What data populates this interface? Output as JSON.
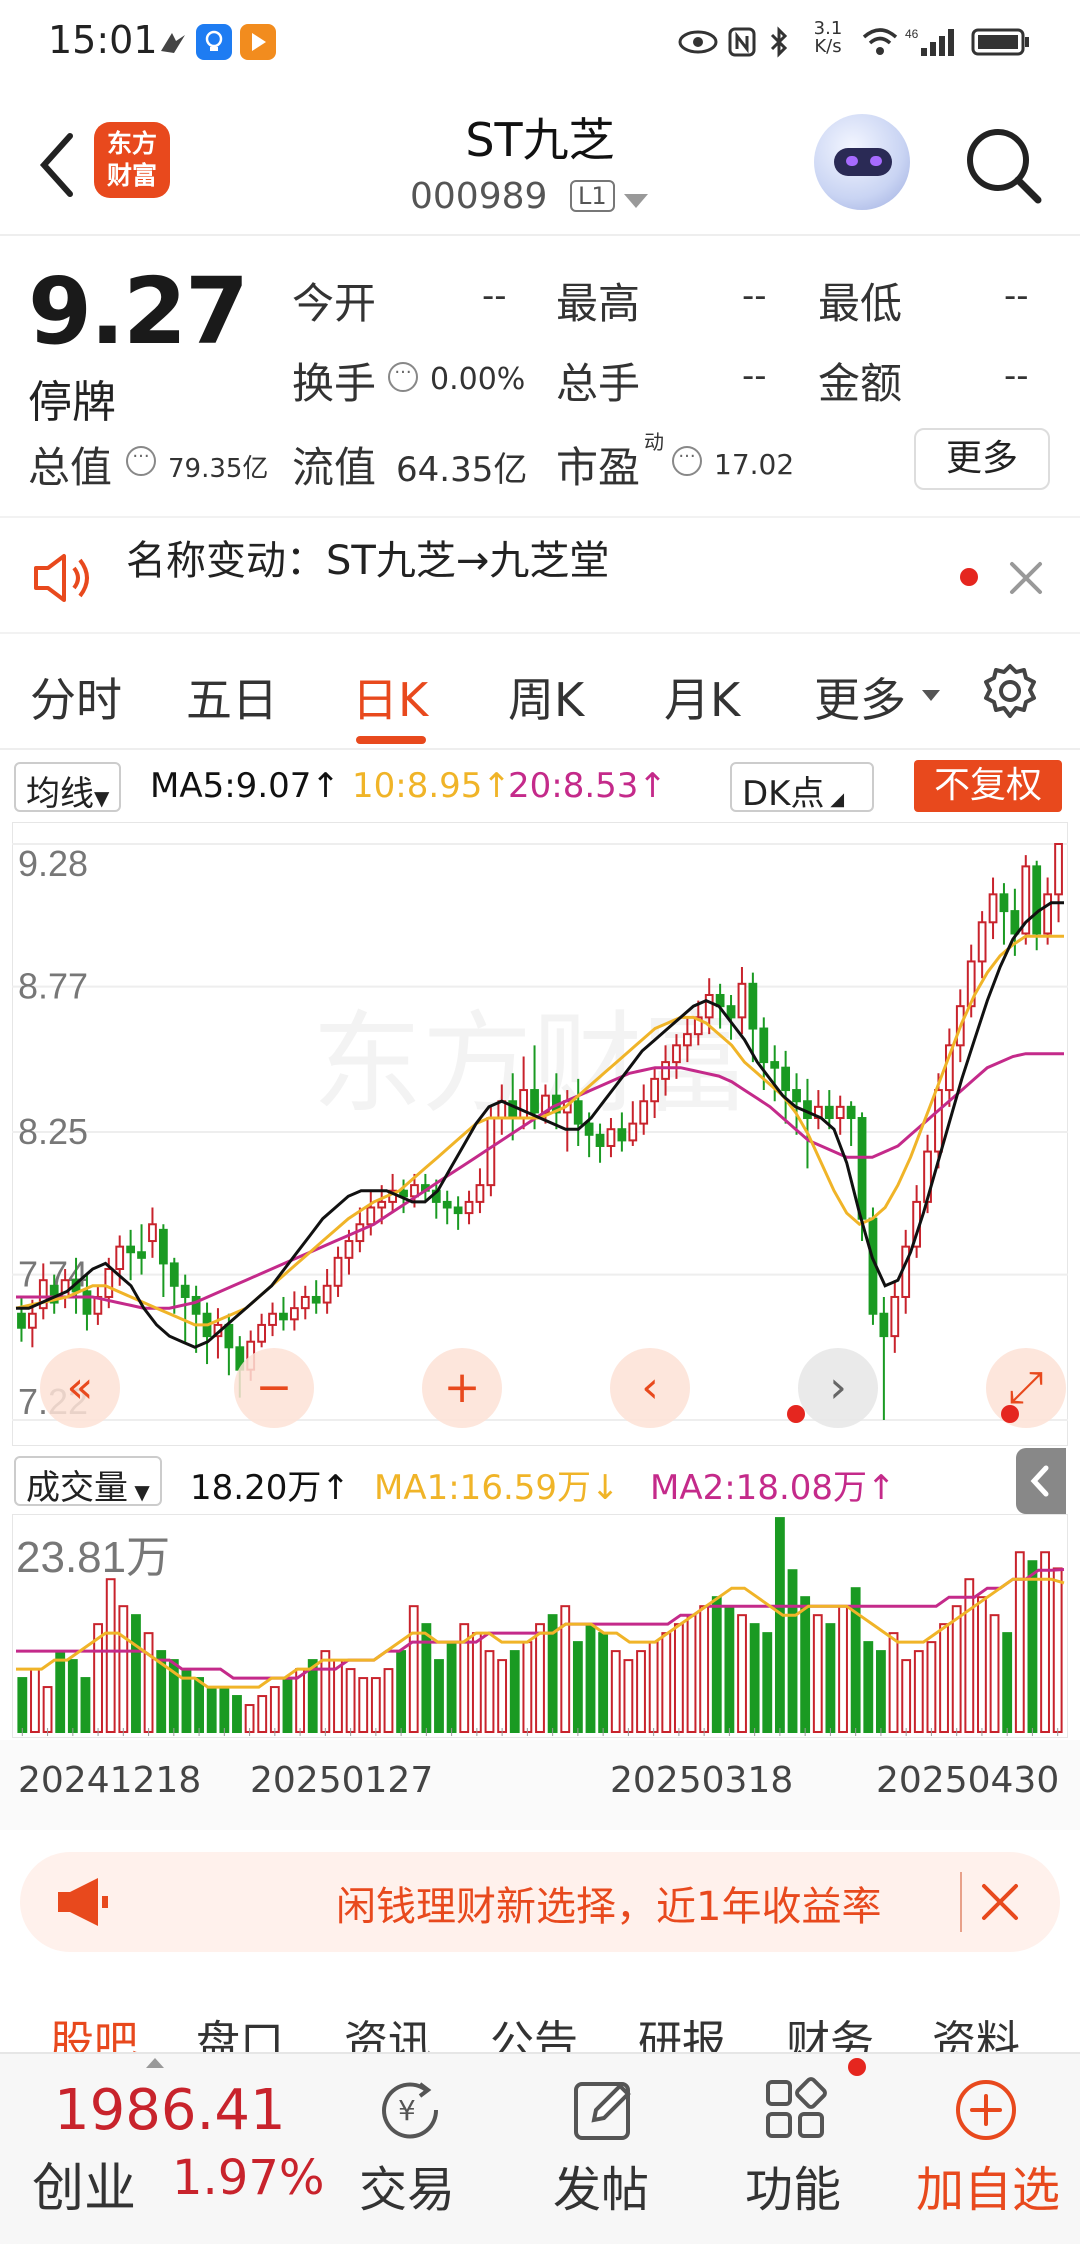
{
  "status_bar": {
    "time": "15:01",
    "net_speed": "3.1\nK/s",
    "signal": "46"
  },
  "header": {
    "logo_text": "东方\n财富",
    "stock_name": "ST九芝",
    "stock_code": "000989",
    "level_badge": "L1"
  },
  "quote": {
    "price": "9.27",
    "status": "停牌",
    "fields": {
      "open_label": "今开",
      "open_value": "--",
      "high_label": "最高",
      "high_value": "--",
      "low_label": "最低",
      "low_value": "--",
      "turnover_label": "换手",
      "turnover_value": "0.00%",
      "volume_label": "总手",
      "volume_value": "--",
      "amount_label": "金额",
      "amount_value": "--",
      "mktcap_label": "总值",
      "mktcap_value": "79.35亿",
      "float_label": "流值",
      "float_value": "64.35亿",
      "pe_label": "市盈",
      "pe_sup": "动",
      "pe_value": "17.02"
    },
    "more_button": "更多"
  },
  "notice": {
    "text": "名称变动：ST九芝→九芝堂"
  },
  "tabs": [
    "分时",
    "五日",
    "日K",
    "周K",
    "月K",
    "更多"
  ],
  "active_tab": "日K",
  "ma_row": {
    "selector": "均线",
    "ma5": "MA5:9.07↑",
    "ma10": "10:8.95↑",
    "ma20": "20:8.53↑",
    "dk": "DK点",
    "adjust": "不复权"
  },
  "colors": {
    "accent": "#e8491d",
    "up": "#c8232c",
    "down": "#1a9a22",
    "ma5": "#111111",
    "ma10": "#f0b428",
    "ma20": "#c42a8a"
  },
  "volume_row": {
    "selector": "成交量",
    "vol": "18.20万↑",
    "ma1": "MA1:16.59万↓",
    "ma2": "MA2:18.08万↑",
    "max_label": "23.81万"
  },
  "chart_data": {
    "type": "candlestick",
    "y_axis_labels": [
      "9.28",
      "8.77",
      "8.25",
      "7.74",
      "7.22"
    ],
    "ylim": [
      7.22,
      9.28
    ],
    "x_labels": [
      "20241218",
      "20250127",
      "20250318",
      "20250430"
    ],
    "candles": [
      [
        7.6,
        7.55,
        7.66,
        7.5
      ],
      [
        7.55,
        7.6,
        7.65,
        7.48
      ],
      [
        7.62,
        7.72,
        7.78,
        7.58
      ],
      [
        7.7,
        7.64,
        7.74,
        7.6
      ],
      [
        7.66,
        7.72,
        7.76,
        7.62
      ],
      [
        7.72,
        7.68,
        7.8,
        7.6
      ],
      [
        7.68,
        7.6,
        7.74,
        7.54
      ],
      [
        7.6,
        7.66,
        7.7,
        7.56
      ],
      [
        7.66,
        7.76,
        7.8,
        7.62
      ],
      [
        7.76,
        7.84,
        7.88,
        7.7
      ],
      [
        7.84,
        7.82,
        7.9,
        7.72
      ],
      [
        7.82,
        7.8,
        7.92,
        7.74
      ],
      [
        7.86,
        7.92,
        7.98,
        7.8
      ],
      [
        7.9,
        7.78,
        7.92,
        7.66
      ],
      [
        7.78,
        7.7,
        7.8,
        7.6
      ],
      [
        7.7,
        7.66,
        7.74,
        7.5
      ],
      [
        7.66,
        7.6,
        7.7,
        7.46
      ],
      [
        7.6,
        7.52,
        7.64,
        7.42
      ],
      [
        7.52,
        7.56,
        7.62,
        7.44
      ],
      [
        7.56,
        7.48,
        7.6,
        7.38
      ],
      [
        7.48,
        7.4,
        7.52,
        7.3
      ],
      [
        7.4,
        7.5,
        7.54,
        7.36
      ],
      [
        7.5,
        7.56,
        7.6,
        7.48
      ],
      [
        7.56,
        7.6,
        7.64,
        7.52
      ],
      [
        7.6,
        7.58,
        7.66,
        7.54
      ],
      [
        7.58,
        7.62,
        7.68,
        7.54
      ],
      [
        7.62,
        7.66,
        7.7,
        7.58
      ],
      [
        7.66,
        7.64,
        7.72,
        7.6
      ],
      [
        7.64,
        7.7,
        7.76,
        7.6
      ],
      [
        7.7,
        7.8,
        7.84,
        7.66
      ],
      [
        7.8,
        7.86,
        7.9,
        7.74
      ],
      [
        7.86,
        7.92,
        7.98,
        7.82
      ],
      [
        7.92,
        7.98,
        8.04,
        7.88
      ],
      [
        7.98,
        8.0,
        8.06,
        7.92
      ],
      [
        8.0,
        8.04,
        8.1,
        7.96
      ],
      [
        8.04,
        8.02,
        8.08,
        7.96
      ],
      [
        8.02,
        8.06,
        8.1,
        7.98
      ],
      [
        8.06,
        8.04,
        8.1,
        8.0
      ],
      [
        8.04,
        8.0,
        8.08,
        7.94
      ],
      [
        8.0,
        7.98,
        8.04,
        7.92
      ],
      [
        7.98,
        7.96,
        8.02,
        7.9
      ],
      [
        7.96,
        8.0,
        8.04,
        7.92
      ],
      [
        8.0,
        8.06,
        8.12,
        7.96
      ],
      [
        8.06,
        8.3,
        8.34,
        8.02
      ],
      [
        8.3,
        8.36,
        8.42,
        8.24
      ],
      [
        8.36,
        8.3,
        8.46,
        8.22
      ],
      [
        8.3,
        8.4,
        8.52,
        8.26
      ],
      [
        8.4,
        8.32,
        8.56,
        8.26
      ],
      [
        8.32,
        8.38,
        8.42,
        8.28
      ],
      [
        8.38,
        8.32,
        8.46,
        8.26
      ],
      [
        8.32,
        8.36,
        8.4,
        8.18
      ],
      [
        8.36,
        8.28,
        8.44,
        8.2
      ],
      [
        8.28,
        8.24,
        8.32,
        8.16
      ],
      [
        8.24,
        8.2,
        8.28,
        8.14
      ],
      [
        8.2,
        8.26,
        8.3,
        8.16
      ],
      [
        8.26,
        8.22,
        8.32,
        8.18
      ],
      [
        8.22,
        8.28,
        8.36,
        8.2
      ],
      [
        8.28,
        8.36,
        8.42,
        8.24
      ],
      [
        8.36,
        8.44,
        8.48,
        8.3
      ],
      [
        8.44,
        8.5,
        8.56,
        8.38
      ],
      [
        8.5,
        8.56,
        8.6,
        8.44
      ],
      [
        8.56,
        8.6,
        8.66,
        8.5
      ],
      [
        8.6,
        8.66,
        8.72,
        8.56
      ],
      [
        8.66,
        8.74,
        8.8,
        8.6
      ],
      [
        8.74,
        8.7,
        8.78,
        8.62
      ],
      [
        8.7,
        8.66,
        8.74,
        8.58
      ],
      [
        8.66,
        8.78,
        8.84,
        8.6
      ],
      [
        8.78,
        8.62,
        8.82,
        8.5
      ],
      [
        8.62,
        8.5,
        8.66,
        8.4
      ],
      [
        8.5,
        8.48,
        8.56,
        8.36
      ],
      [
        8.48,
        8.4,
        8.54,
        8.28
      ],
      [
        8.4,
        8.36,
        8.46,
        8.24
      ],
      [
        8.36,
        8.3,
        8.44,
        8.12
      ],
      [
        8.3,
        8.34,
        8.4,
        8.26
      ],
      [
        8.34,
        8.3,
        8.4,
        8.26
      ],
      [
        8.3,
        8.34,
        8.38,
        8.24
      ],
      [
        8.34,
        8.3,
        8.36,
        8.2
      ],
      [
        8.3,
        7.94,
        8.32,
        7.86
      ],
      [
        7.94,
        7.6,
        7.98,
        7.56
      ],
      [
        7.6,
        7.52,
        7.66,
        7.22
      ],
      [
        7.52,
        7.66,
        7.72,
        7.46
      ],
      [
        7.66,
        7.84,
        7.9,
        7.6
      ],
      [
        7.84,
        8.0,
        8.06,
        7.8
      ],
      [
        8.0,
        8.18,
        8.24,
        7.96
      ],
      [
        8.18,
        8.4,
        8.46,
        8.12
      ],
      [
        8.4,
        8.56,
        8.62,
        8.34
      ],
      [
        8.56,
        8.7,
        8.76,
        8.5
      ],
      [
        8.7,
        8.86,
        8.92,
        8.66
      ],
      [
        8.86,
        9.0,
        9.04,
        8.8
      ],
      [
        9.0,
        9.1,
        9.16,
        8.94
      ],
      [
        9.1,
        9.04,
        9.14,
        8.92
      ],
      [
        9.04,
        8.96,
        9.12,
        8.88
      ],
      [
        8.96,
        9.2,
        9.24,
        8.92
      ],
      [
        9.2,
        8.96,
        9.22,
        8.9
      ],
      [
        8.96,
        9.1,
        9.16,
        8.92
      ],
      [
        9.1,
        9.28,
        9.28,
        9.0
      ]
    ],
    "ma5": [
      7.62,
      7.62,
      7.64,
      7.66,
      7.68,
      7.72,
      7.76,
      7.78,
      7.74,
      7.7,
      7.62,
      7.56,
      7.52,
      7.5,
      7.48,
      7.5,
      7.54,
      7.58,
      7.62,
      7.66,
      7.7,
      7.76,
      7.82,
      7.88,
      7.94,
      7.98,
      8.02,
      8.04,
      8.04,
      8.04,
      8.02,
      8.0,
      8.0,
      8.04,
      8.12,
      8.2,
      8.28,
      8.34,
      8.36,
      8.34,
      8.32,
      8.3,
      8.28,
      8.26,
      8.26,
      8.3,
      8.36,
      8.42,
      8.48,
      8.54,
      8.58,
      8.62,
      8.66,
      8.7,
      8.72,
      8.7,
      8.64,
      8.58,
      8.5,
      8.44,
      8.38,
      8.34,
      8.32,
      8.3,
      8.26,
      8.14,
      7.96,
      7.8,
      7.7,
      7.72,
      7.82,
      7.96,
      8.12,
      8.28,
      8.44,
      8.58,
      8.72,
      8.84,
      8.94,
      9.0,
      9.04,
      9.07,
      9.07
    ],
    "ma10": [
      7.62,
      7.63,
      7.64,
      7.65,
      7.66,
      7.68,
      7.7,
      7.7,
      7.68,
      7.66,
      7.64,
      7.62,
      7.6,
      7.58,
      7.56,
      7.56,
      7.58,
      7.6,
      7.62,
      7.66,
      7.7,
      7.74,
      7.78,
      7.82,
      7.86,
      7.9,
      7.94,
      7.97,
      8.0,
      8.02,
      8.04,
      8.08,
      8.12,
      8.16,
      8.2,
      8.24,
      8.28,
      8.3,
      8.3,
      8.3,
      8.3,
      8.3,
      8.32,
      8.34,
      8.38,
      8.42,
      8.46,
      8.5,
      8.54,
      8.58,
      8.62,
      8.64,
      8.66,
      8.66,
      8.64,
      8.6,
      8.56,
      8.5,
      8.46,
      8.42,
      8.38,
      8.32,
      8.24,
      8.14,
      8.04,
      7.96,
      7.92,
      7.94,
      7.98,
      8.06,
      8.16,
      8.28,
      8.4,
      8.52,
      8.64,
      8.74,
      8.82,
      8.88,
      8.92,
      8.95,
      8.95,
      8.95,
      8.95
    ],
    "ma20": [
      7.66,
      7.66,
      7.66,
      7.66,
      7.66,
      7.66,
      7.66,
      7.65,
      7.64,
      7.63,
      7.62,
      7.62,
      7.62,
      7.63,
      7.64,
      7.66,
      7.68,
      7.7,
      7.72,
      7.74,
      7.76,
      7.78,
      7.8,
      7.82,
      7.84,
      7.86,
      7.88,
      7.9,
      7.92,
      7.95,
      7.98,
      8.01,
      8.04,
      8.07,
      8.1,
      8.13,
      8.16,
      8.19,
      8.22,
      8.25,
      8.28,
      8.31,
      8.34,
      8.36,
      8.38,
      8.4,
      8.42,
      8.44,
      8.46,
      8.47,
      8.48,
      8.48,
      8.48,
      8.47,
      8.46,
      8.45,
      8.43,
      8.4,
      8.37,
      8.34,
      8.3,
      8.26,
      8.22,
      8.2,
      8.18,
      8.16,
      8.16,
      8.16,
      8.18,
      8.2,
      8.24,
      8.28,
      8.32,
      8.36,
      8.4,
      8.44,
      8.48,
      8.5,
      8.52,
      8.53,
      8.53,
      8.53,
      8.53
    ],
    "volume": [
      6,
      7,
      5,
      9,
      8,
      6,
      12,
      17,
      14,
      13,
      11,
      9,
      8,
      7,
      6,
      5,
      5,
      4,
      3,
      4,
      5,
      6,
      7,
      8,
      9,
      8,
      7,
      6,
      6,
      7,
      9,
      14,
      12,
      8,
      10,
      12,
      11,
      9,
      8,
      9,
      10,
      12,
      13,
      14,
      10,
      12,
      11,
      9,
      8,
      9,
      10,
      11,
      12,
      13,
      14,
      15,
      14,
      13,
      12,
      11,
      23.8,
      18,
      15,
      13,
      12,
      14,
      16,
      10,
      9,
      11,
      8,
      9,
      10,
      12,
      14,
      17,
      15,
      13,
      11,
      20,
      19,
      20,
      18.2
    ],
    "vol_ma1": [
      7,
      7,
      7,
      8,
      8,
      9,
      10,
      11,
      11,
      10,
      9,
      8,
      7,
      6,
      6,
      5,
      5,
      5,
      5,
      5,
      6,
      6,
      7,
      7,
      8,
      8,
      8,
      8,
      8,
      9,
      10,
      11,
      11,
      10,
      10,
      10,
      11,
      11,
      10,
      10,
      10,
      11,
      11,
      12,
      12,
      12,
      11,
      11,
      10,
      10,
      10,
      11,
      12,
      13,
      14,
      15,
      16,
      16,
      15,
      14,
      13,
      13,
      14,
      14,
      14,
      14,
      13,
      12,
      11,
      10,
      10,
      10,
      11,
      12,
      13,
      14,
      15,
      16,
      17,
      17,
      17,
      17,
      16.59
    ],
    "vol_ma2": [
      9,
      9,
      9,
      9,
      9,
      9,
      9,
      9,
      9,
      9,
      9,
      8,
      8,
      7,
      7,
      7,
      7,
      6,
      6,
      6,
      6,
      6,
      6,
      7,
      7,
      7,
      8,
      8,
      8,
      9,
      9,
      10,
      10,
      10,
      10,
      10,
      10,
      11,
      11,
      11,
      11,
      11,
      11,
      12,
      12,
      12,
      12,
      12,
      12,
      12,
      12,
      12,
      13,
      13,
      14,
      14,
      14,
      14,
      14,
      14,
      14,
      14,
      14,
      14,
      14,
      14,
      14,
      14,
      14,
      14,
      14,
      14,
      14,
      15,
      15,
      15,
      16,
      16,
      17,
      17,
      18,
      18,
      18.08
    ]
  },
  "ad": {
    "text": "闲钱理财新选择，近1年收益率"
  },
  "sub_tabs": [
    "股吧",
    "盘口",
    "资讯",
    "公告",
    "研报",
    "财务",
    "资料"
  ],
  "bottom_bar": {
    "index_value": "1986.41",
    "index_name": "创业",
    "index_change": "1.97%",
    "items": [
      "交易",
      "发帖",
      "功能",
      "加自选"
    ]
  }
}
